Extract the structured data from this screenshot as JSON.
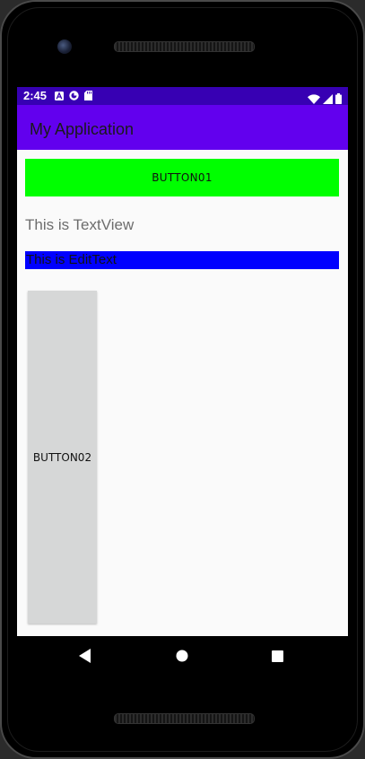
{
  "status_bar": {
    "time": "2:45",
    "left_icons": [
      "a-letter-icon",
      "logo-icon",
      "sd-card-icon"
    ],
    "right_icons": [
      "wifi-icon",
      "signal-icon",
      "battery-icon"
    ],
    "color": "#3700b3"
  },
  "app_bar": {
    "title": "My Application",
    "color": "#6200ee"
  },
  "content": {
    "button01": {
      "label": "BUTTON01",
      "color": "#00ff00"
    },
    "textview": {
      "text": "This is TextView",
      "color": "#6d6d6d"
    },
    "edittext": {
      "value": "This is EditText",
      "color": "#0000ff"
    },
    "button02": {
      "label": "BUTTON02",
      "color": "#d6d7d7"
    }
  },
  "nav_bar": {
    "buttons": [
      "back-icon",
      "home-icon",
      "recents-icon"
    ]
  }
}
